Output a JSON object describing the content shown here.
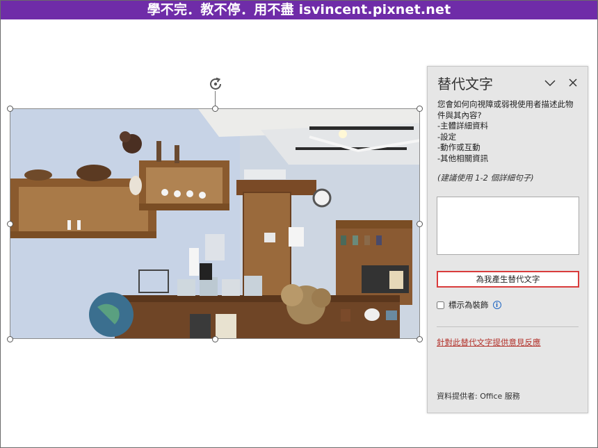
{
  "banner": {
    "text": "學不完．教不停．用不盡 isvincent.pixnet.net"
  },
  "image": {
    "selected": true
  },
  "alt_text_pane": {
    "title": "替代文字",
    "icons": {
      "collapse": "chevron-down-icon",
      "close": "close-icon",
      "rotate": "rotate-icon",
      "info": "info-icon"
    },
    "description": "您會如何向視障或弱視使用者描述此物件與其內容?\n-主體詳細資料\n-設定\n-動作或互動\n-其他相關資訊",
    "hint": "(建議使用 1-2 個詳細句子)",
    "alt_text_value": "",
    "generate_button": "為我產生替代文字",
    "decorative_label": "標示為裝飾",
    "decorative_checked": false,
    "feedback_link": "針對此替代文字提供意見反應",
    "provider": "資料提供者: Office 服務"
  },
  "colors": {
    "banner_bg": "#6f2ca8",
    "pane_bg": "#e6e6e6",
    "highlight_border": "#d93b3b",
    "link": "#b3332c",
    "info": "#1f66c2"
  }
}
